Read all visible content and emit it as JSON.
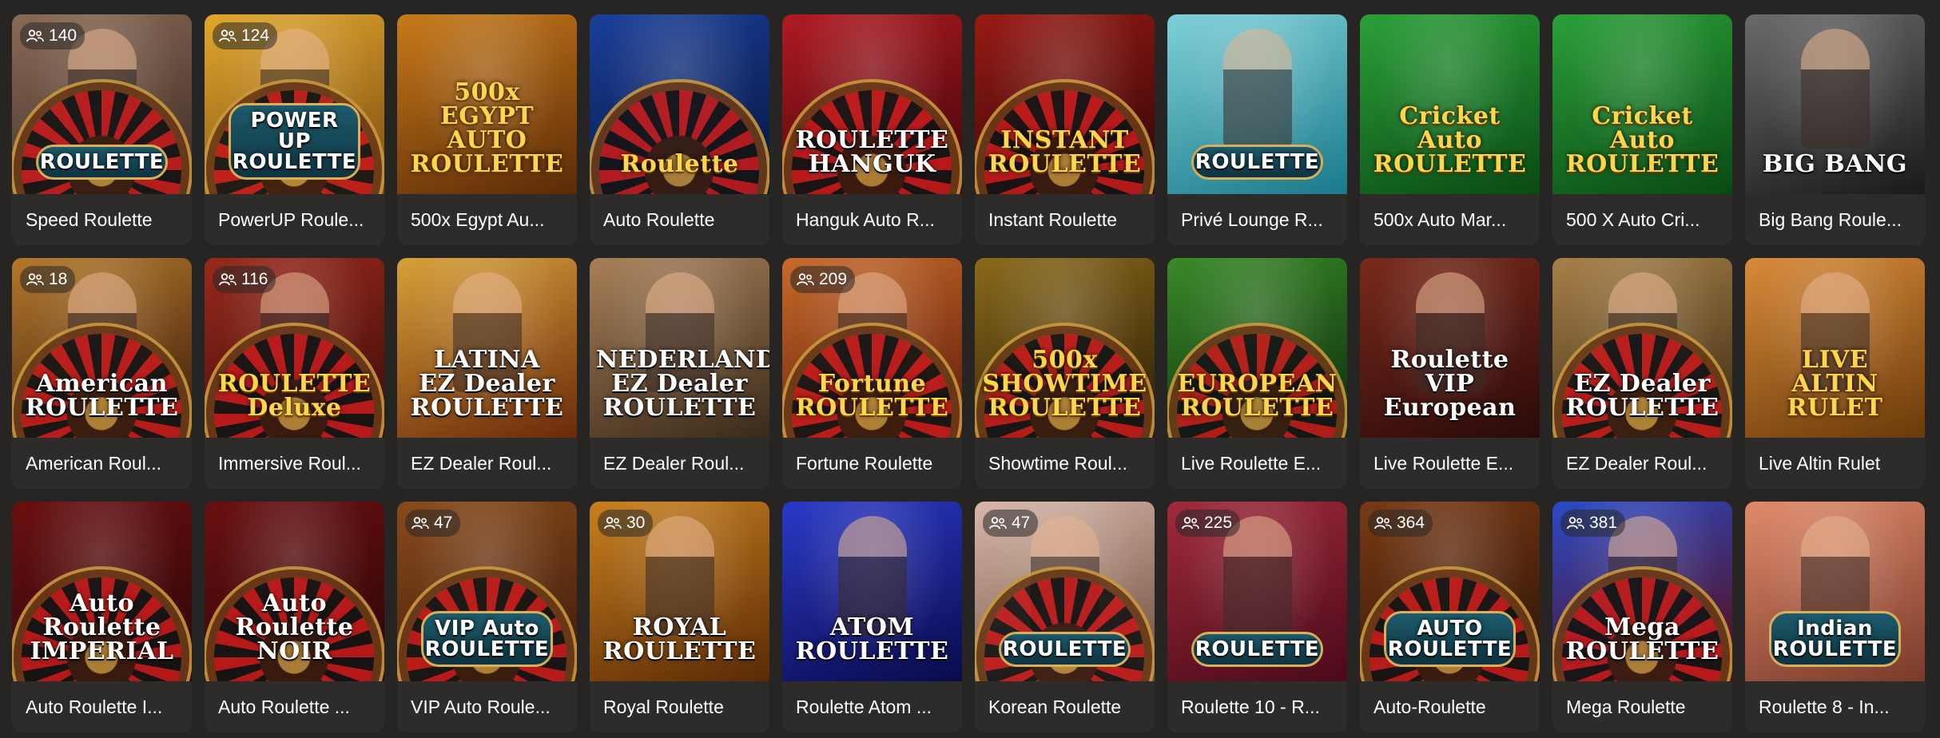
{
  "games": [
    {
      "title": "Speed Roulette",
      "players": "140",
      "art": "ROULETTE",
      "style": "badge",
      "bg": [
        "#3b2a22",
        "#8a6a55"
      ],
      "wheel": true,
      "person": true
    },
    {
      "title": "PowerUP Roule...",
      "players": "124",
      "art": "POWER UP\nROULETTE",
      "style": "badge",
      "bg": [
        "#7a4a10",
        "#e2a72c"
      ],
      "wheel": true,
      "person": true
    },
    {
      "title": "500x Egypt Au...",
      "players": "",
      "art": "500x\nEGYPT\nAUTO\nROULETTE",
      "style": "gold",
      "bg": [
        "#5a2a08",
        "#c87a18"
      ],
      "wheel": false,
      "person": false
    },
    {
      "title": "Auto Roulette",
      "players": "",
      "art": "Roulette",
      "style": "gold",
      "bg": [
        "#06143a",
        "#1a3f9a"
      ],
      "wheel": true,
      "person": false
    },
    {
      "title": "Hanguk Auto R...",
      "players": "",
      "art": "ROULETTE\nHANGUK",
      "style": "plain",
      "bg": [
        "#3a0508",
        "#b21a22"
      ],
      "wheel": true,
      "person": false
    },
    {
      "title": "Instant Roulette",
      "players": "",
      "art": "INSTANT\nROULETTE",
      "style": "gold",
      "bg": [
        "#2a0606",
        "#9a1a14"
      ],
      "wheel": true,
      "person": false
    },
    {
      "title": "Privé Lounge R...",
      "players": "",
      "art": "ROULETTE",
      "style": "badge",
      "bg": [
        "#1a7a8a",
        "#7fd0d8"
      ],
      "wheel": false,
      "person": true
    },
    {
      "title": "500x Auto Mar...",
      "players": "",
      "art": "Cricket Auto\nROULETTE",
      "style": "gold",
      "bg": [
        "#0a4a14",
        "#2aa038"
      ],
      "wheel": false,
      "person": false
    },
    {
      "title": "500 X Auto Cri...",
      "players": "",
      "art": "Cricket Auto\nROULETTE",
      "style": "gold",
      "bg": [
        "#0a4a14",
        "#2aa038"
      ],
      "wheel": false,
      "person": false
    },
    {
      "title": "Big Bang Roule...",
      "players": "",
      "art": "BIG BANG",
      "style": "plain",
      "bg": [
        "#1a1a1a",
        "#6a6a6a"
      ],
      "wheel": false,
      "person": true
    },
    {
      "title": "American Roul...",
      "players": "18",
      "art": "American\nROULETTE",
      "style": "plain",
      "bg": [
        "#3a1a0a",
        "#b4782a"
      ],
      "wheel": true,
      "person": true
    },
    {
      "title": "Immersive Roul...",
      "players": "116",
      "art": "ROULETTE\nDeluxe",
      "style": "gold",
      "bg": [
        "#3a0a0a",
        "#9a2a1a"
      ],
      "wheel": true,
      "person": true
    },
    {
      "title": "EZ Dealer Roul...",
      "players": "",
      "art": "LATINA\nEZ Dealer\nROULETTE",
      "style": "plain",
      "bg": [
        "#6a2a0a",
        "#d8a038"
      ],
      "wheel": false,
      "person": true
    },
    {
      "title": "EZ Dealer Roul...",
      "players": "",
      "art": "NEDERLANDS\nEZ Dealer\nROULETTE",
      "style": "plain",
      "bg": [
        "#3a2a1a",
        "#a88058"
      ],
      "wheel": false,
      "person": true
    },
    {
      "title": "Fortune Roulette",
      "players": "209",
      "art": "Fortune\nROULETTE",
      "style": "gold",
      "bg": [
        "#5a1a0a",
        "#c86a2a"
      ],
      "wheel": true,
      "person": true
    },
    {
      "title": "Showtime Roul...",
      "players": "",
      "art": "500x\nSHOWTIME\nROULETTE",
      "style": "gold",
      "bg": [
        "#2a1a06",
        "#8a6a1a"
      ],
      "wheel": true,
      "person": false
    },
    {
      "title": "Live Roulette E...",
      "players": "",
      "art": "EUROPEAN\nROULETTE",
      "style": "gold",
      "bg": [
        "#0a2a0a",
        "#3a8a28"
      ],
      "wheel": true,
      "person": false
    },
    {
      "title": "Live Roulette E...",
      "players": "",
      "art": "Roulette\nVIP European",
      "style": "plain",
      "bg": [
        "#2a0a0a",
        "#7a2a1a"
      ],
      "wheel": false,
      "person": true
    },
    {
      "title": "EZ Dealer Roul...",
      "players": "",
      "art": "EZ Dealer\nROULETTE",
      "style": "plain",
      "bg": [
        "#3a2a14",
        "#a88048"
      ],
      "wheel": true,
      "person": true
    },
    {
      "title": "Live Altin Rulet",
      "players": "",
      "art": "LIVE\nALTIN\nRULET",
      "style": "gold",
      "bg": [
        "#6a3a0a",
        "#d88a38"
      ],
      "wheel": false,
      "person": true
    },
    {
      "title": "Auto Roulette I...",
      "players": "",
      "art": "Auto\nRoulette   IMPERIAL",
      "style": "plain",
      "bg": [
        "#2a0606",
        "#6a1010"
      ],
      "wheel": true,
      "person": false
    },
    {
      "title": "Auto Roulette ...",
      "players": "",
      "art": "Auto\nRoulette   NOIR",
      "style": "plain",
      "bg": [
        "#2a0606",
        "#6a1010"
      ],
      "wheel": true,
      "person": false
    },
    {
      "title": "VIP Auto Roule...",
      "players": "47",
      "art": "VIP Auto\nROULETTE",
      "style": "badge",
      "bg": [
        "#3a1a0a",
        "#8a4a1a"
      ],
      "wheel": true,
      "person": false
    },
    {
      "title": "Royal Roulette",
      "players": "30",
      "art": "ROYAL\nROULETTE",
      "style": "plain",
      "bg": [
        "#5a2a06",
        "#c8801e"
      ],
      "wheel": false,
      "person": true
    },
    {
      "title": "Roulette Atom ...",
      "players": "",
      "art": "ATOM\nROULETTE",
      "style": "plain",
      "bg": [
        "#0a0a4a",
        "#2a3ac8"
      ],
      "wheel": false,
      "person": true
    },
    {
      "title": "Korean Roulette",
      "players": "47",
      "art": "ROULETTE",
      "style": "badge",
      "bg": [
        "#6a4a3a",
        "#d8b8a8"
      ],
      "wheel": true,
      "person": true
    },
    {
      "title": "Roulette 10 - R...",
      "players": "225",
      "art": "ROULETTE",
      "style": "badge",
      "bg": [
        "#4a0a1a",
        "#a02a3a"
      ],
      "wheel": false,
      "person": true
    },
    {
      "title": "Auto-Roulette",
      "players": "364",
      "art": "AUTO\nROULETTE",
      "style": "badge",
      "bg": [
        "#2a1206",
        "#7a3a14"
      ],
      "wheel": true,
      "person": false
    },
    {
      "title": "Mega Roulette",
      "players": "381",
      "art": "Mega\nROULETTE",
      "style": "plain",
      "bg": [
        "#5a0a0a",
        "#2a4ac8"
      ],
      "wheel": true,
      "person": true
    },
    {
      "title": "Roulette 8 - In...",
      "players": "",
      "art": "Indian\nROULETTE",
      "style": "badge",
      "bg": [
        "#7a3a2a",
        "#e08a6a"
      ],
      "wheel": false,
      "person": true
    }
  ]
}
